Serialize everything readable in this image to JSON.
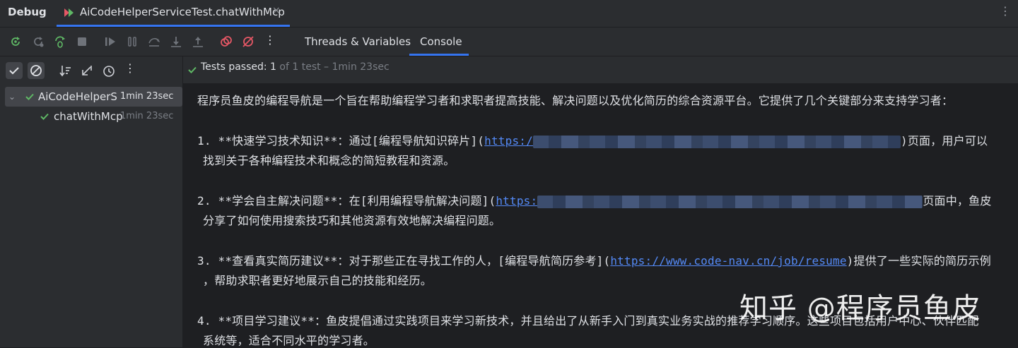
{
  "topbar": {
    "debug_label": "Debug",
    "tab_title": "AiCodeHelperServiceTest.chatWithMcp",
    "tab_close": "×",
    "more": "⋮"
  },
  "toolbar": {
    "more": "⋮",
    "tabs": [
      {
        "label": "Threads & Variables",
        "active": false
      },
      {
        "label": "Console",
        "active": true
      }
    ]
  },
  "tree_toolbar": {
    "more": "⋮"
  },
  "tree": [
    {
      "name": "AiCodeHelperSer",
      "time": "1min 23sec",
      "expanded": true,
      "selected": true,
      "status": "passed"
    },
    {
      "name": "chatWithMcp",
      "time": "1min 23sec",
      "selected": false,
      "status": "passed"
    }
  ],
  "status": {
    "prefix": "Tests passed: ",
    "count": "1",
    "suffix": " of 1 test – 1min 23sec"
  },
  "console": {
    "intro": "程序员鱼皮的编程导航是一个旨在帮助编程学习者和求职者提高技能、解决问题以及优化简历的综合资源平台。它提供了几个关键部分来支持学习者：",
    "item1_a": "1. **快速学习技术知识**：通过[编程导航知识碎片](",
    "item1_link": "https:/",
    "item1_b": ")页面，用户可以",
    "item1_line2": "找到关于各种编程技术和概念的简短教程和资源。",
    "item2_a": "2. **学会自主解决问题**：在[利用编程导航解决问题](",
    "item2_link": "https:",
    "item2_b": "页面中，鱼皮",
    "item2_line2": "分享了如何使用搜索技巧和其他资源有效地解决编程问题。",
    "item3_a": "3. **查看真实简历建议**：对于那些正在寻找工作的人，[编程导航简历参考](",
    "item3_link": "https://www.code-nav.cn/job/resume",
    "item3_b": ")提供了一些实际的简历示例",
    "item3_line2": "，帮助求职者更好地展示自己的技能和经历。",
    "item4_a": "4. **项目学习建议**：鱼皮提倡通过实践项目来学习新技术，并且给出了从新手入门到真实业务实战的推荐学习顺序。这些项目包括用户中心、伙伴匹配",
    "item4_line2": "系统等，适合不同水平的学习者。"
  },
  "watermark": "知乎 @程序员鱼皮",
  "colors": {
    "accent": "#3574f0",
    "passed": "#5fb865",
    "stop_red": "#e55765",
    "link": "#548af7"
  }
}
